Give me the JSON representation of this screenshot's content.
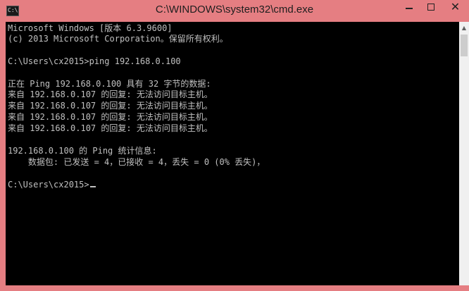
{
  "window": {
    "title": "C:\\WINDOWS\\system32\\cmd.exe",
    "icon": "cmd-icon",
    "accent_color": "#e57e82",
    "buttons": {
      "minimize_icon": "minimize-icon",
      "maximize_icon": "maximize-icon",
      "close_icon": "close-icon",
      "close_glyph": "✕"
    }
  },
  "console": {
    "background": "#000000",
    "foreground": "#c0c0c0",
    "lines": [
      "Microsoft Windows [版本 6.3.9600]",
      "(c) 2013 Microsoft Corporation。保留所有权利。",
      "",
      "C:\\Users\\cx2015>ping 192.168.0.100",
      "",
      "正在 Ping 192.168.0.100 具有 32 字节的数据:",
      "来自 192.168.0.107 的回复: 无法访问目标主机。",
      "来自 192.168.0.107 的回复: 无法访问目标主机。",
      "来自 192.168.0.107 的回复: 无法访问目标主机。",
      "来自 192.168.0.107 的回复: 无法访问目标主机。",
      "",
      "192.168.0.100 的 Ping 统计信息:",
      "    数据包: 已发送 = 4，已接收 = 4，丢失 = 0 (0% 丢失)，",
      "",
      "C:\\Users\\cx2015>"
    ]
  }
}
